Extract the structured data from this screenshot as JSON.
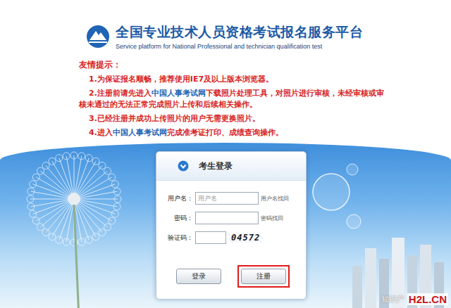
{
  "header": {
    "title": "全国专业技术人员资格考试报名服务平台",
    "subtitle": "Service platform for National Professional and technician qualification test"
  },
  "tips": {
    "heading": "友情提示：",
    "items": [
      {
        "segments": [
          {
            "kind": "text",
            "text": "1.为保证报名顺畅，推荐使用IE7及以上版本浏览器。"
          }
        ]
      },
      {
        "segments": [
          {
            "kind": "text",
            "text": "2.注册前请先进入"
          },
          {
            "kind": "link",
            "text": "中国人事考试网"
          },
          {
            "kind": "text",
            "text": "下载照片处理工具，对照片进行审核，未经审核或审核未通过的无法正常完成照片上传和后续相关操作。"
          }
        ]
      },
      {
        "segments": [
          {
            "kind": "text",
            "text": "3.已经注册并成功上传照片的用户无需更换照片。"
          }
        ]
      },
      {
        "segments": [
          {
            "kind": "text",
            "text": "4.进入"
          },
          {
            "kind": "link",
            "text": "中国人事考试网"
          },
          {
            "kind": "text",
            "text": "完成准考证打印、成绩查询操作。"
          }
        ]
      }
    ]
  },
  "login": {
    "title": "考生登录",
    "fields": [
      {
        "kind": "text",
        "label": "用户名：",
        "placeholder": "用户名",
        "link": "用户名找回"
      },
      {
        "kind": "password",
        "label": "密码：",
        "link": "密码找回"
      },
      {
        "kind": "captcha",
        "label": "验证码：",
        "captcha": "04572"
      }
    ],
    "buttons": [
      {
        "label": "登录",
        "highlighted": false
      },
      {
        "label": "注册",
        "highlighted": true
      }
    ]
  },
  "watermark": {
    "text": "知识产",
    "badge": "H2L.CN"
  }
}
